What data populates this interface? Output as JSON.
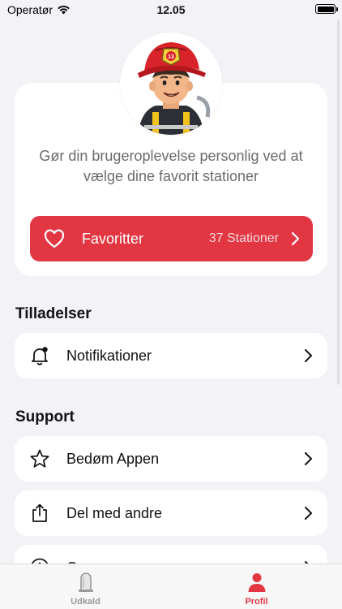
{
  "status_bar": {
    "carrier": "Operatør",
    "time": "12.05",
    "wifi_icon": "wifi-icon",
    "battery_icon": "battery-icon"
  },
  "profile": {
    "avatar_icon": "firefighter-avatar",
    "description": "Gør din brugeroplevelse personlig ved at vælge dine favorit stationer",
    "favorites_button": {
      "label": "Favoritter",
      "count": "37 Stationer",
      "icon": "heart-icon",
      "color": "#e23643"
    }
  },
  "permissions": {
    "title": "Tilladelser",
    "items": [
      {
        "label": "Notifikationer",
        "icon": "bell-icon"
      }
    ]
  },
  "support": {
    "title": "Support",
    "items": [
      {
        "label": "Bedøm Appen",
        "icon": "star-icon"
      },
      {
        "label": "Del med andre",
        "icon": "share-icon"
      },
      {
        "label": "Om appen",
        "icon": "info-icon"
      }
    ]
  },
  "tab_bar": {
    "tabs": [
      {
        "label": "Udkald",
        "icon": "siren-icon",
        "active": false
      },
      {
        "label": "Profil",
        "icon": "person-icon",
        "active": true
      }
    ],
    "accent": "#e23643"
  }
}
